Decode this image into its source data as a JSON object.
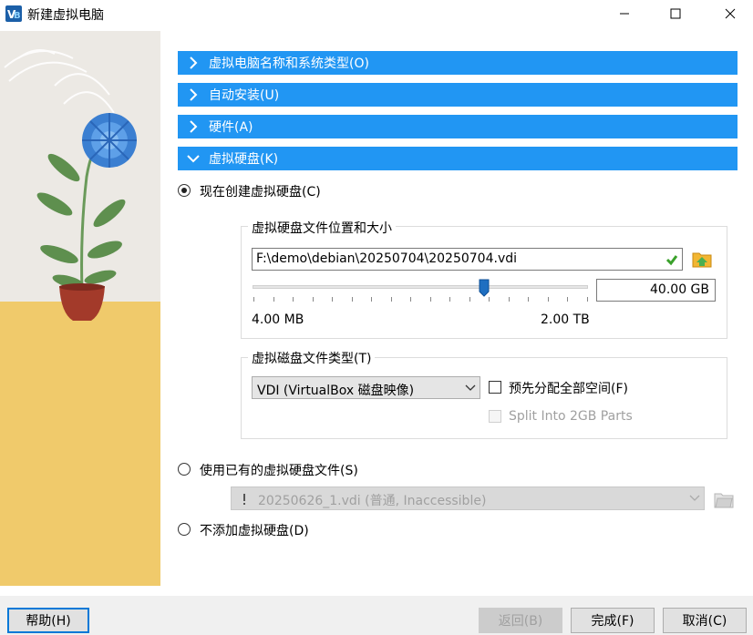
{
  "window": {
    "title": "新建虚拟电脑",
    "minimize_icon": "minimize-icon",
    "maximize_icon": "maximize-icon",
    "close_icon": "close-icon"
  },
  "sections": [
    {
      "label": "虚拟电脑名称和系统类型(O)",
      "expanded": false
    },
    {
      "label": "自动安装(U)",
      "expanded": false
    },
    {
      "label": "硬件(A)",
      "expanded": false
    },
    {
      "label": "虚拟硬盘(K)",
      "expanded": true
    }
  ],
  "disk": {
    "create_new_label": "现在创建虚拟硬盘(C)",
    "location_group_title": "虚拟硬盘文件位置和大小",
    "path_value": "F:\\demo\\debian\\20250704\\20250704.vdi",
    "size_value": "40.00 GB",
    "size_fraction": 0.69,
    "min_label": "4.00 MB",
    "max_label": "2.00 TB",
    "type_group_title": "虚拟磁盘文件类型(T)",
    "type_selected": "VDI (VirtualBox 磁盘映像)",
    "preallocate_label": "预先分配全部空间(F)",
    "split_label": "Split Into 2GB Parts",
    "use_existing_label": "使用已有的虚拟硬盘文件(S)",
    "existing_file": "20250626_1.vdi (普通, Inaccessible)",
    "no_disk_label": "不添加虚拟硬盘(D)"
  },
  "buttons": {
    "help": "帮助(H)",
    "back": "返回(B)",
    "finish": "完成(F)",
    "cancel": "取消(C)"
  },
  "colors": {
    "section_bar": "#2196f3",
    "side_yellow": "#f0ca6b"
  }
}
